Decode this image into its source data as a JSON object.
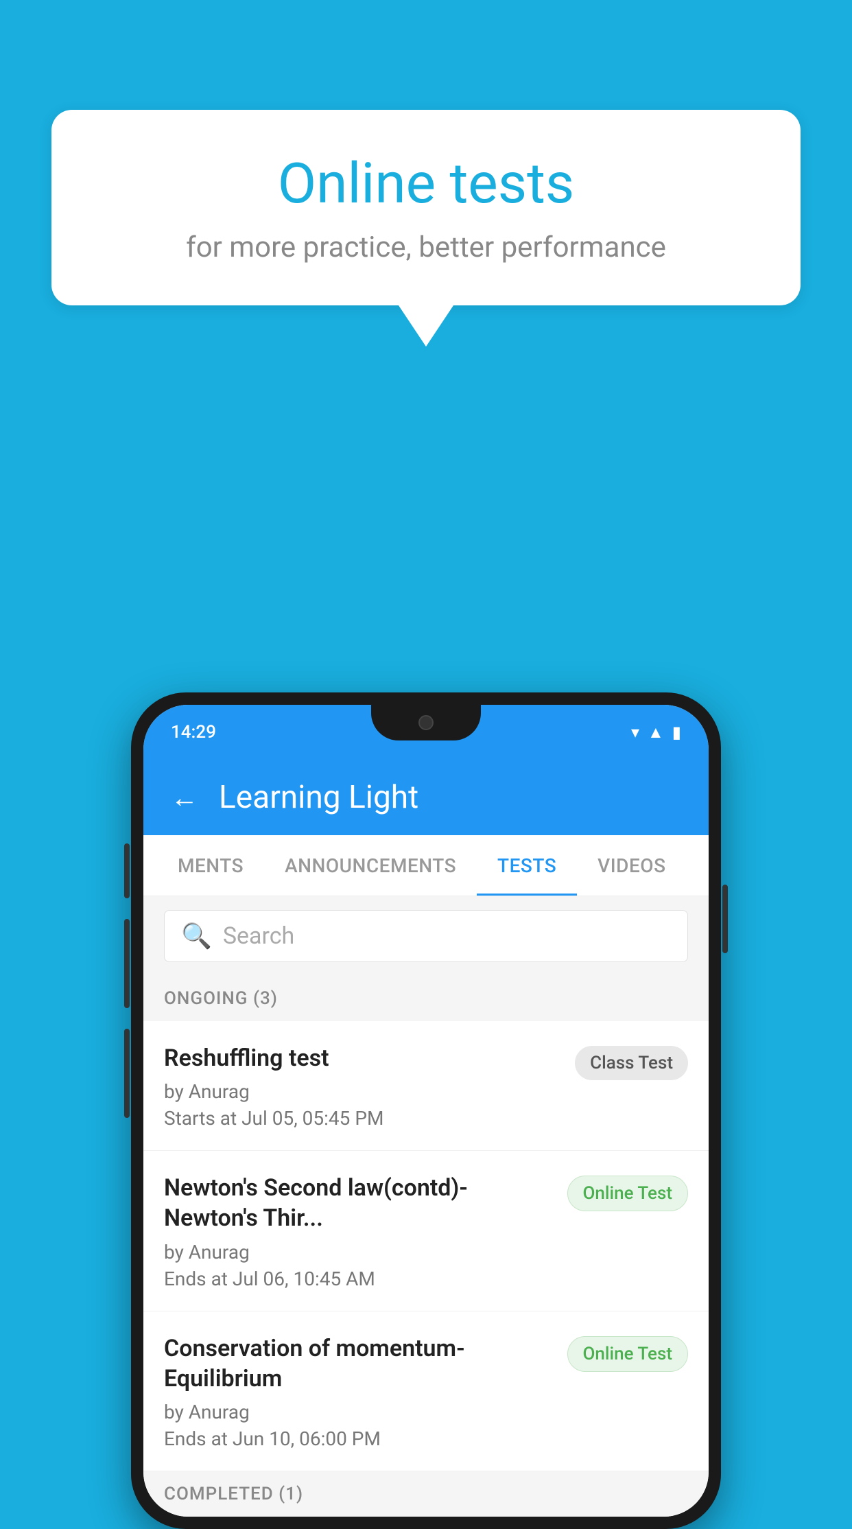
{
  "background": {
    "color": "#19AEDE"
  },
  "speech_bubble": {
    "title": "Online tests",
    "subtitle": "for more practice, better performance"
  },
  "phone": {
    "status_bar": {
      "time": "14:29",
      "icons": [
        "wifi",
        "signal",
        "battery"
      ]
    },
    "header": {
      "back_label": "←",
      "title": "Learning Light"
    },
    "tabs": [
      {
        "label": "MENTS",
        "active": false
      },
      {
        "label": "ANNOUNCEMENTS",
        "active": false
      },
      {
        "label": "TESTS",
        "active": true
      },
      {
        "label": "VIDEOS",
        "active": false
      }
    ],
    "search": {
      "placeholder": "Search"
    },
    "ongoing_section": {
      "label": "ONGOING (3)"
    },
    "tests": [
      {
        "title": "Reshuffling test",
        "author": "by Anurag",
        "date": "Starts at  Jul 05, 05:45 PM",
        "badge": "Class Test",
        "badge_type": "class"
      },
      {
        "title": "Newton's Second law(contd)-Newton's Thir...",
        "author": "by Anurag",
        "date": "Ends at  Jul 06, 10:45 AM",
        "badge": "Online Test",
        "badge_type": "online"
      },
      {
        "title": "Conservation of momentum-Equilibrium",
        "author": "by Anurag",
        "date": "Ends at  Jun 10, 06:00 PM",
        "badge": "Online Test",
        "badge_type": "online"
      }
    ],
    "completed_section": {
      "label": "COMPLETED (1)"
    }
  }
}
